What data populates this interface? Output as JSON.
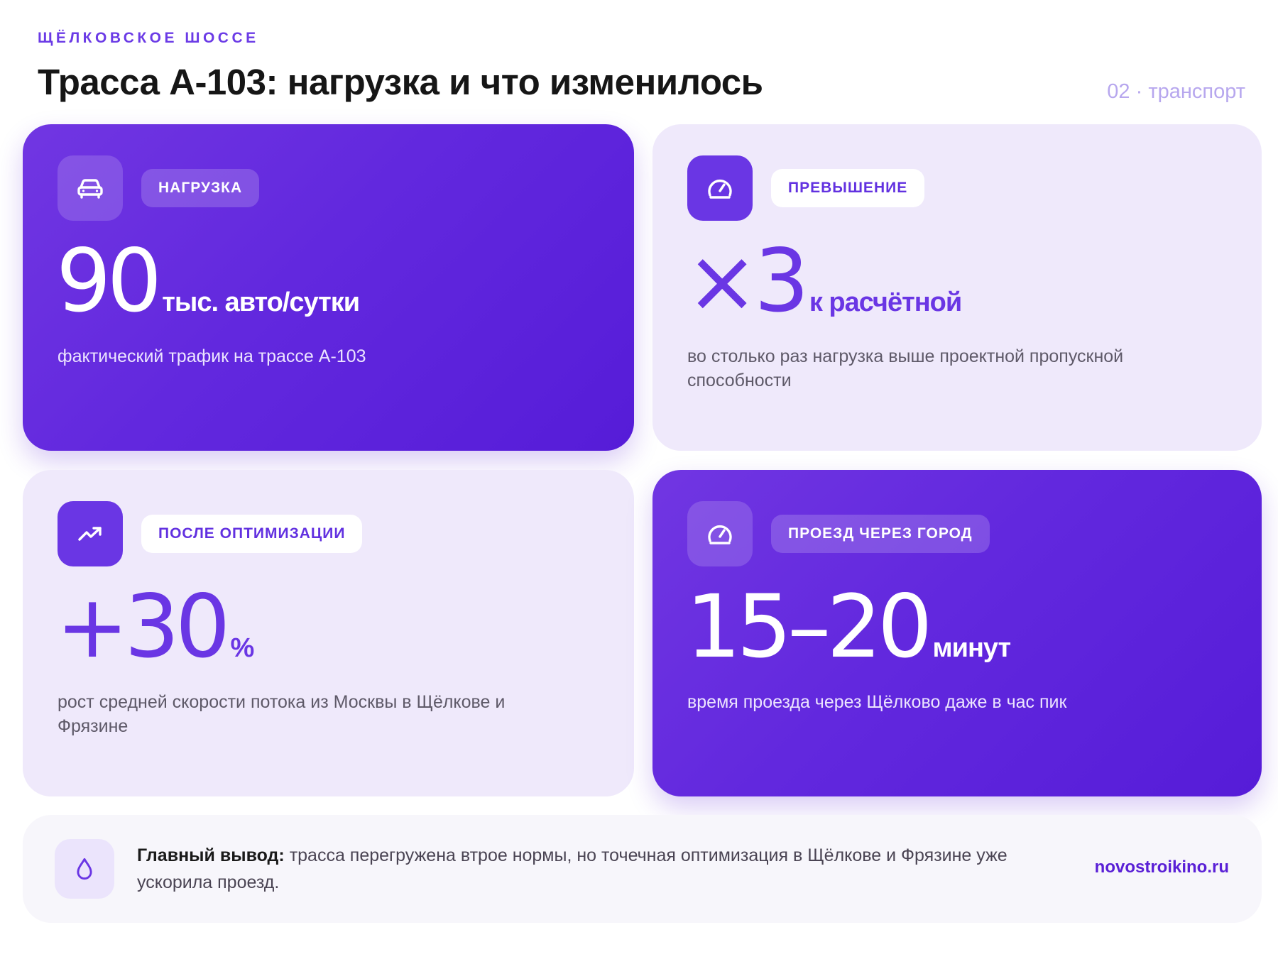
{
  "header": {
    "eyebrow": "ЩЁЛКОВСКОЕ ШОССЕ",
    "title": "Трасса А-103: нагрузка и что изменилось",
    "tag": "02 · транспорт"
  },
  "cards": [
    {
      "style": "dark",
      "icon": "car-icon",
      "pill": "НАГРУЗКА",
      "value": "90",
      "unit": "тыс. авто/сутки",
      "description": "фактический трафик на трассе А-103"
    },
    {
      "style": "light",
      "icon": "speedometer-icon",
      "pill": "ПРЕВЫШЕНИЕ",
      "value": "×3",
      "unit": "к расчётной",
      "description": "во столько раз нагрузка выше проектной пропускной способности"
    },
    {
      "style": "light",
      "icon": "trend-up-icon",
      "pill": "ПОСЛЕ ОПТИМИЗАЦИИ",
      "value": "+30",
      "unit": "%",
      "description": "рост средней скорости потока из Москвы в Щёлкове и Фрязине"
    },
    {
      "style": "dark",
      "icon": "speedometer-icon",
      "pill": "ПРОЕЗД ЧЕРЕЗ ГОРОД",
      "value": "15–20",
      "unit": "минут",
      "description": "время проезда через Щёлково даже в час пик"
    }
  ],
  "conclusion": {
    "icon": "drop-icon",
    "lead": "Главный вывод:",
    "text": " трасса перегружена втрое нормы, но точечная оптимизация в Щёлкове и Фрязине уже ускорила проезд.",
    "site": "novostroikino.ru"
  },
  "colors": {
    "accent": "#6a36e4",
    "dark_card_start": "#7136e2",
    "dark_card_end": "#561cd8",
    "light_card": "#efe9fb",
    "tag": "#b7a7ee"
  }
}
